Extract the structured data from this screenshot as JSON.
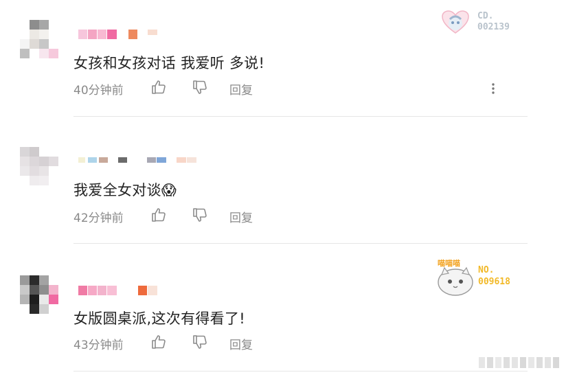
{
  "comments": [
    {
      "text": "女孩和女孩对话 我爱听 多说!",
      "time": "40分钟前",
      "reply": "回复",
      "badge": {
        "line1": "CD.",
        "line2": "002139"
      }
    },
    {
      "text": "我爱全女对谈",
      "emoji": "😱",
      "time": "42分钟前",
      "reply": "回复"
    },
    {
      "text": "女版圆桌派,这次有得看了!",
      "time": "43分钟前",
      "reply": "回复",
      "badge": {
        "line1": "NO.",
        "line2": "009618",
        "sticker_text": "喵喵喵"
      }
    }
  ],
  "colors": {
    "comment_text": "#222222",
    "meta_text": "#8a8a8a",
    "divider": "#e6e6e6",
    "badge_cd": "#b9c3cc",
    "badge_no": "#f2b928"
  },
  "icons": [
    "thumbs-up-icon",
    "thumbs-down-icon",
    "more-vertical-icon"
  ]
}
